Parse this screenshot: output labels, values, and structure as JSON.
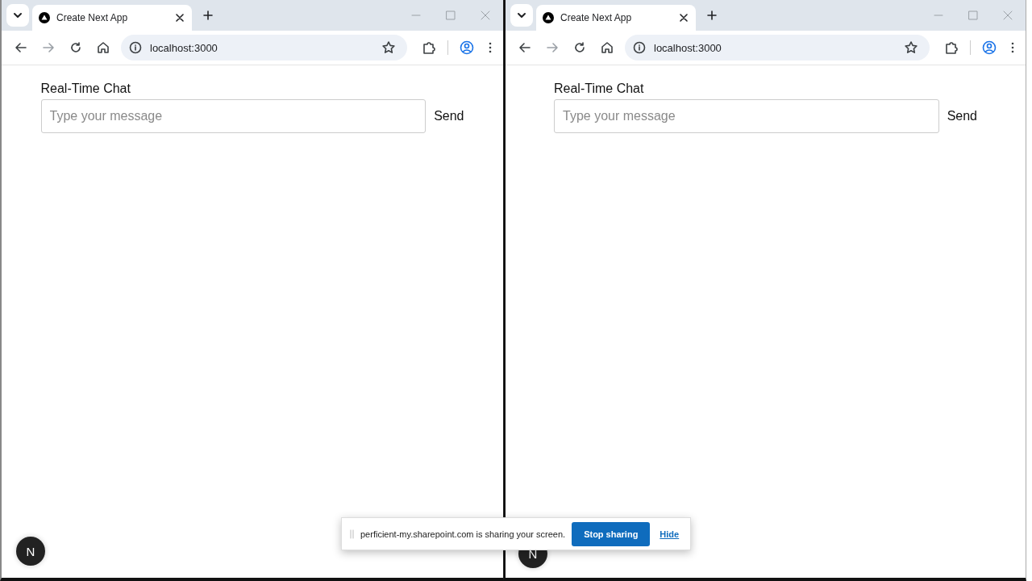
{
  "windows": [
    {
      "tab": {
        "title": "Create Next App",
        "selected": true
      },
      "url": "localhost:3000",
      "app": {
        "heading": "Real-Time Chat",
        "message_field": {
          "placeholder": "Type your message"
        },
        "send_button": "Send"
      },
      "dev_badge": {
        "letter": "N"
      }
    },
    {
      "tab": {
        "title": "Create Next App",
        "selected": true
      },
      "url": "localhost:3000",
      "app": {
        "heading": "Real-Time Chat",
        "message_field": {
          "placeholder": "Type your message"
        },
        "send_button": "Send"
      },
      "dev_badge": {
        "letter": "N"
      }
    }
  ],
  "sharing_bar": {
    "message": "perficient-my.sharepoint.com is sharing your screen.",
    "stop_button": "Stop sharing",
    "hide_link": "Hide"
  }
}
